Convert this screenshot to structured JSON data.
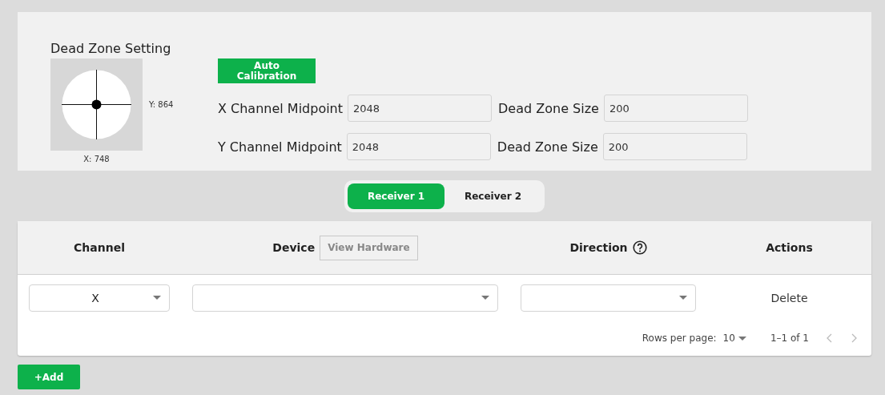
{
  "dead_zone": {
    "title": "Dead Zone Setting",
    "y_reading": "Y: 864",
    "x_reading": "X: 748"
  },
  "auto_calibration": {
    "label": "Auto Calibration"
  },
  "rows": [
    {
      "label": "X Channel Midpoint",
      "value": "2048",
      "size_label": "Dead Zone Size",
      "size_value": "200"
    },
    {
      "label": "Y Channel Midpoint",
      "value": "2048",
      "size_label": "Dead Zone Size",
      "size_value": "200"
    }
  ],
  "tabs": [
    {
      "label": "Receiver 1",
      "selected": true
    },
    {
      "label": "Receiver 2",
      "selected": false
    }
  ],
  "table": {
    "columns": [
      {
        "kind": "plain",
        "label": "Channel"
      },
      {
        "kind": "hardware",
        "label": "Device",
        "button": "View Hardware"
      },
      {
        "kind": "help",
        "label": "Direction"
      },
      {
        "kind": "plain",
        "label": "Actions"
      }
    ],
    "rows": [
      {
        "channel": "X",
        "action": "Delete"
      }
    ],
    "pagination": {
      "rows_per_page_label": "Rows per page:",
      "rows_per_page": "10",
      "range": "1–1 of 1"
    }
  },
  "add_button": "+Add"
}
